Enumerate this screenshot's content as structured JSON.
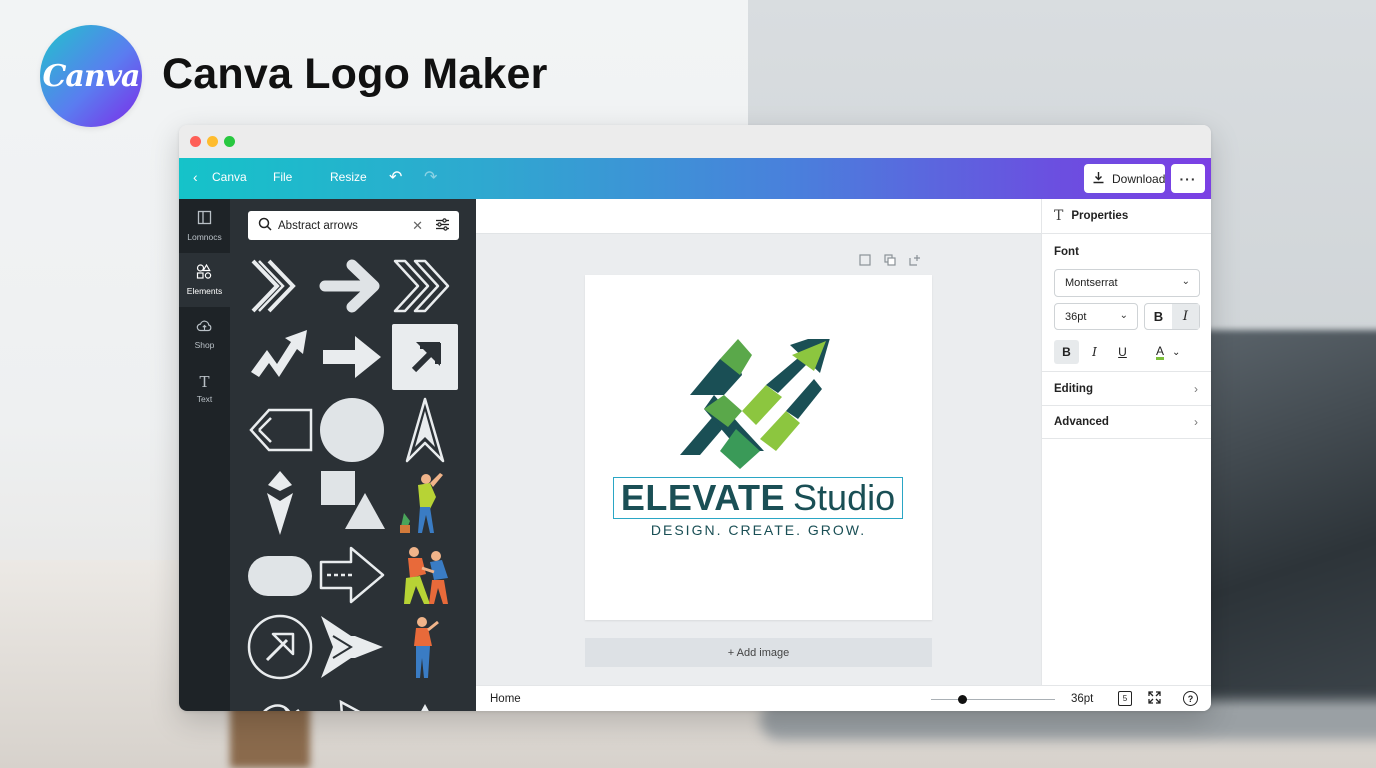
{
  "brand": {
    "logo_text": "Canva",
    "title": "Canva Logo Maker"
  },
  "toolbar": {
    "back_label": "Canva",
    "file_label": "File",
    "resize_label": "Resize",
    "download_label": "Download"
  },
  "rail": {
    "items": [
      {
        "label": "Lomnocs",
        "icon": "layout-icon"
      },
      {
        "label": "Elements",
        "icon": "shapes-icon"
      },
      {
        "label": "Shop",
        "icon": "cloud-icon"
      },
      {
        "label": "Text",
        "icon": "text-icon"
      }
    ],
    "active": "Elements"
  },
  "panel": {
    "search_value": "Abstract arrows",
    "tiles": [
      "double-chevron-right",
      "arrow-right-rounded",
      "triple-chevron-outline",
      "zigzag-arrow",
      "arrow-right-block",
      "diagonal-arrow-square",
      "outline-arrow-left",
      "circle",
      "arrowhead-up",
      "double-arrowhead-down",
      "square-triangle",
      "person-illustration-1",
      "rounded-pill",
      "dashed-arrow-right",
      "people-illustration-2",
      "circle-arrow",
      "chevron-arrow-right",
      "person-illustration-3"
    ]
  },
  "canvas": {
    "logo_name_bold": "ELEVATE",
    "logo_name_light": "Studio",
    "logo_tagline": "DESIGN. CREATE. GROW.",
    "add_image_label": "+ Add image",
    "colors": {
      "dark_teal": "#1a4f55",
      "green": "#7bbf3a",
      "selection": "#2aa6c5"
    }
  },
  "properties": {
    "header": "Properties",
    "font_label": "Font",
    "font_value": "Montserrat",
    "size_value": "36pt",
    "bold_label": "B",
    "italic_label": "I",
    "underline_label": "U",
    "color_label": "A",
    "editing_label": "Editing",
    "advanced_label": "Advanced"
  },
  "bottombar": {
    "home_label": "Home",
    "zoom_value": "36pt",
    "zoom_level": 0.25
  },
  "theme": {
    "toolbar_gradient": [
      "#15c3c9",
      "#7b3fe4"
    ]
  }
}
